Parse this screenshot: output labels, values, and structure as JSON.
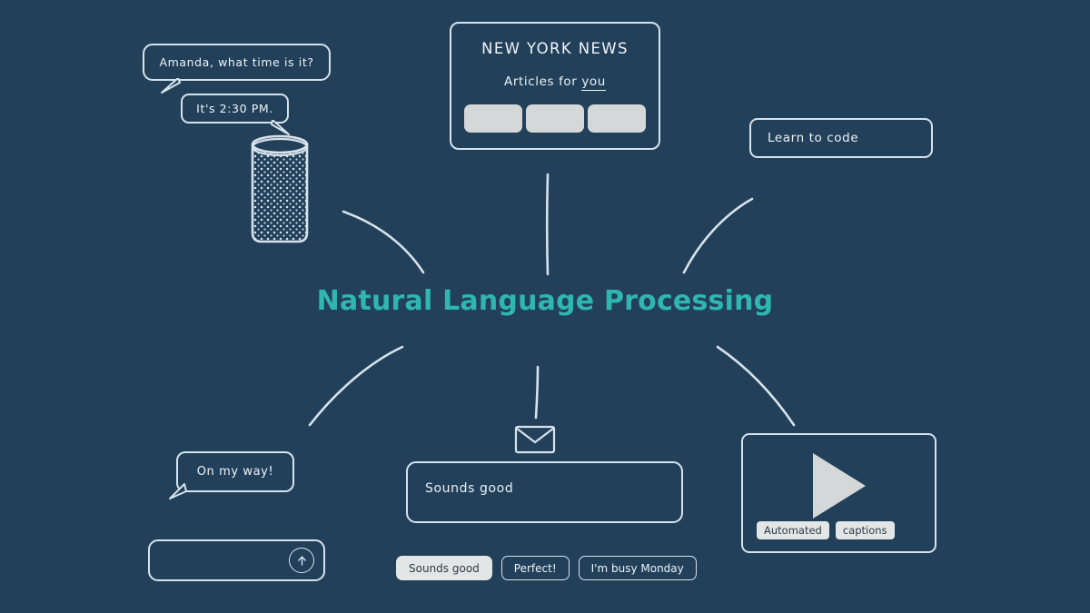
{
  "canvas": {
    "background_color": "#22405a",
    "ink_color": "#d6e3ec",
    "accent_color": "#2fb6b0",
    "fill_color": "#d5d8d8"
  },
  "center": {
    "title": "Natural Language Processing"
  },
  "voice_assistant": {
    "question_bubble": "Amanda, what time is it?",
    "answer_bubble": "It's 2:30 PM.",
    "device_icon": "smart-speaker-icon"
  },
  "news_card": {
    "title": "NEW YORK NEWS",
    "subtitle_prefix": "Articles for ",
    "subtitle_underlined": "you",
    "thumbnails": [
      "article-thumb-1",
      "article-thumb-2",
      "article-thumb-3"
    ]
  },
  "learn_card": {
    "label": "Learn to code"
  },
  "messaging": {
    "reply_bubble": "On my way!",
    "input_placeholder": "",
    "send_icon": "arrow-up-circle-icon"
  },
  "email": {
    "envelope_icon": "envelope-icon",
    "compose_text": "Sounds good",
    "suggestions": [
      {
        "label": "Sounds good",
        "style": "filled"
      },
      {
        "label": "Perfect!",
        "style": "outline"
      },
      {
        "label": "I'm busy Monday",
        "style": "outline"
      }
    ]
  },
  "video": {
    "play_icon": "play-triangle-icon",
    "captions": [
      "Automated",
      "captions"
    ]
  }
}
